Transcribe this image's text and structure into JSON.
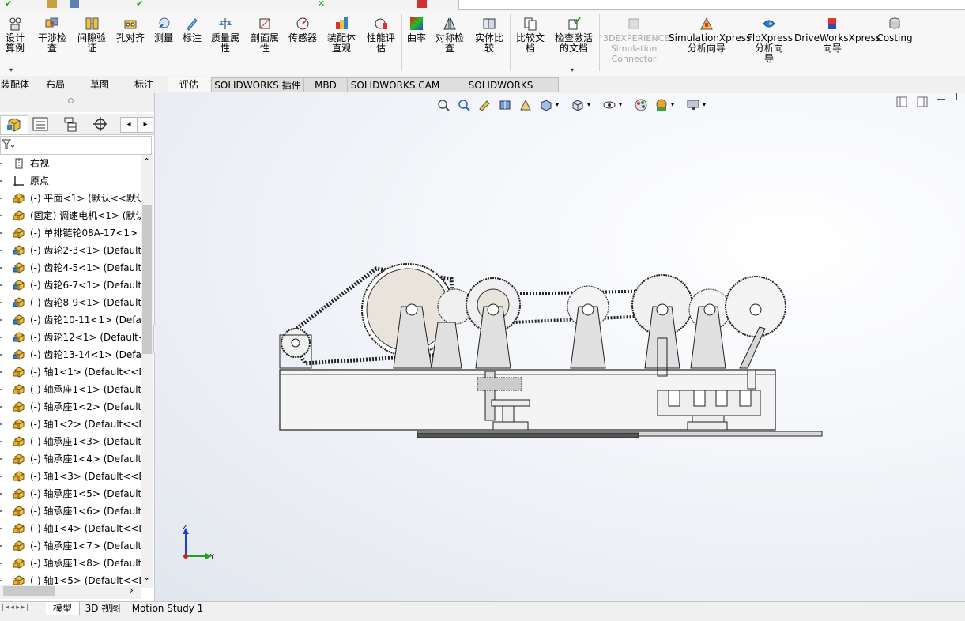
{
  "ribbon": {
    "design_study_label": "设计算例",
    "buttons": [
      {
        "id": "interference",
        "label": "干涉检查"
      },
      {
        "id": "clearance",
        "label": "间隙验证"
      },
      {
        "id": "hole-align",
        "label": "孔对齐"
      },
      {
        "id": "measure",
        "label": "测量"
      },
      {
        "id": "markup",
        "label": "标注"
      },
      {
        "id": "mass-props",
        "label": "质量属性"
      },
      {
        "id": "section-props",
        "label": "剖面属性"
      },
      {
        "id": "sensor",
        "label": "传感器"
      },
      {
        "id": "assembly-visual",
        "label": "装配体直观"
      },
      {
        "id": "perf-eval",
        "label": "性能评估"
      },
      {
        "id": "curvature",
        "label": "曲率"
      },
      {
        "id": "symmetry",
        "label": "对称检查"
      },
      {
        "id": "compare-geom",
        "label": "实体比较"
      },
      {
        "id": "compare-docs",
        "label": "比较文档"
      },
      {
        "id": "check-active",
        "label": "检查激活的文档"
      }
    ],
    "disabled_button": "3DEXPERIENCE Simulation Connector",
    "right_buttons": [
      {
        "id": "simxpress",
        "label_top": "SimulationXpress",
        "label_bottom": "分析向导"
      },
      {
        "id": "floxpress",
        "label_top": "FloXpress",
        "label_bottom": "分析向导"
      },
      {
        "id": "driveworks",
        "label_top": "DriveWorksXpress",
        "label_bottom": "向导"
      },
      {
        "id": "costing",
        "label_top": "Costing",
        "label_bottom": ""
      }
    ]
  },
  "tabs": [
    "装配体",
    "布局",
    "草图",
    "标注",
    "评估",
    "SOLIDWORKS 插件",
    "MBD",
    "SOLIDWORKS CAM",
    "SOLIDWORKS Inspection"
  ],
  "active_tab": "评估",
  "tree": [
    {
      "label": "右视",
      "icon": "plane"
    },
    {
      "label": "原点",
      "icon": "origin"
    },
    {
      "label": "(-) 平面<1> (默认<<默认",
      "icon": "part-yellow"
    },
    {
      "label": "(固定) 调速电机<1> (默认",
      "icon": "part-yellow"
    },
    {
      "label": "(-) 单排链轮08A-17<1> (",
      "icon": "part-yellow"
    },
    {
      "label": "(-) 齿轮2-3<1> (Default<",
      "icon": "part-blue"
    },
    {
      "label": "(-) 齿轮4-5<1> (Default<",
      "icon": "part-blue"
    },
    {
      "label": "(-) 齿轮6-7<1> (Default<",
      "icon": "part-blue"
    },
    {
      "label": "(-) 齿轮8-9<1> (Default<",
      "icon": "part-blue"
    },
    {
      "label": "(-) 齿轮10-11<1> (Defau",
      "icon": "part-blue"
    },
    {
      "label": "(-) 齿轮12<1> (Default<",
      "icon": "part-blue"
    },
    {
      "label": "(-) 齿轮13-14<1> (Defau",
      "icon": "part-blue"
    },
    {
      "label": "(-) 轴1<1> (Default<<De",
      "icon": "part-yellow"
    },
    {
      "label": "(-) 轴承座1<1> (Default<",
      "icon": "part-yellow"
    },
    {
      "label": "(-) 轴承座1<2> (Default<",
      "icon": "part-yellow"
    },
    {
      "label": "(-) 轴1<2> (Default<<De",
      "icon": "part-yellow"
    },
    {
      "label": "(-) 轴承座1<3> (Default<",
      "icon": "part-yellow"
    },
    {
      "label": "(-) 轴承座1<4> (Default<",
      "icon": "part-yellow"
    },
    {
      "label": "(-) 轴1<3> (Default<<De",
      "icon": "part-yellow"
    },
    {
      "label": "(-) 轴承座1<5> (Default<",
      "icon": "part-yellow"
    },
    {
      "label": "(-) 轴承座1<6> (Default<",
      "icon": "part-yellow"
    },
    {
      "label": "(-) 轴1<4> (Default<<De",
      "icon": "part-yellow"
    },
    {
      "label": "(-) 轴承座1<7> (Default<",
      "icon": "part-yellow"
    },
    {
      "label": "(-) 轴承座1<8> (Default<",
      "icon": "part-yellow"
    },
    {
      "label": "(-) 轴1<5> (Default<<De",
      "icon": "part-yellow"
    }
  ],
  "bottom_tabs": [
    "模型",
    "3D 视图",
    "Motion Study 1"
  ],
  "triad": {
    "z": "Z",
    "y": "Y"
  },
  "colors": {
    "accent": "#1f6fd1",
    "disabled": "#a8a8a8"
  }
}
